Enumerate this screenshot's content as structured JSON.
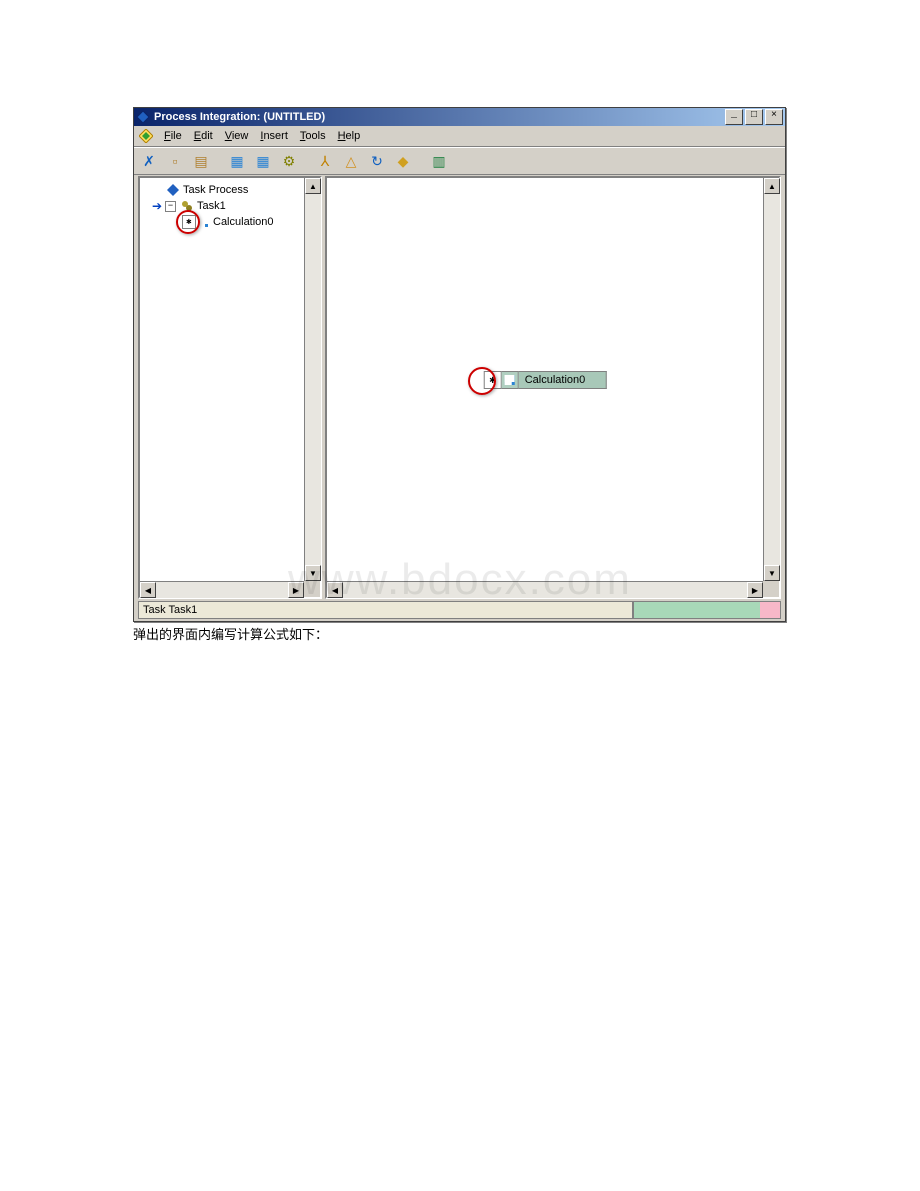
{
  "window": {
    "title": "Process Integration:  (UNTITLED)",
    "btn_min": "_",
    "btn_max": "□",
    "btn_close": "×"
  },
  "menu": {
    "file": {
      "u": "F",
      "rest": "ile"
    },
    "edit": {
      "u": "E",
      "rest": "dit"
    },
    "view": {
      "u": "V",
      "rest": "iew"
    },
    "insert": {
      "u": "I",
      "rest": "nsert"
    },
    "tools": {
      "u": "T",
      "rest": "ools"
    },
    "help": {
      "u": "H",
      "rest": "elp"
    }
  },
  "toolbar": [
    {
      "name": "x-icon",
      "glyph": "✗",
      "color": "#1060c0"
    },
    {
      "name": "new-icon",
      "glyph": "▫",
      "color": "#b08030"
    },
    {
      "name": "save-icon",
      "glyph": "▤",
      "color": "#b08030"
    },
    {
      "name": "table-blue-icon",
      "glyph": "▦",
      "color": "#2b83d4"
    },
    {
      "name": "grid-icon",
      "glyph": "▦",
      "color": "#2b83d4"
    },
    {
      "name": "gears-icon",
      "glyph": "⚙",
      "color": "#808000"
    },
    {
      "name": "tree-icon",
      "glyph": "⅄",
      "color": "#c08000"
    },
    {
      "name": "tree2-icon",
      "glyph": "△",
      "color": "#d09020"
    },
    {
      "name": "refresh-icon",
      "glyph": "↻",
      "color": "#1060c0"
    },
    {
      "name": "diamond-icon",
      "glyph": "◆",
      "color": "#d0a020"
    },
    {
      "name": "chart-icon",
      "glyph": "▥",
      "color": "#208040"
    }
  ],
  "tree": {
    "root": {
      "label": "Task Process"
    },
    "task": {
      "label": "Task1"
    },
    "calc": {
      "label": "Calculation0"
    }
  },
  "tree_glyphs": {
    "arrow": "➔",
    "minus": "−",
    "star": "✱"
  },
  "canvas": {
    "node": {
      "port_glyph": "✱",
      "label": "Calculation0"
    }
  },
  "scroll": {
    "up": "▲",
    "down": "▼",
    "left": "◀",
    "right": "▶"
  },
  "status": {
    "text": "Task Task1"
  },
  "caption": "弹出的界面内编写计算公式如下：",
  "watermark": "www.bdocx.com"
}
